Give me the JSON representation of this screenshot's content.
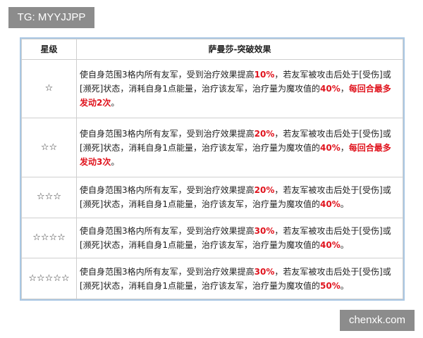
{
  "watermarks": {
    "top_left": "TG: MYYJJPP",
    "bottom_right": "chenxk.com"
  },
  "table": {
    "headers": [
      "星级",
      "萨曼莎-突破效果"
    ],
    "rows": [
      {
        "stars": "☆",
        "segments": [
          {
            "text": "使自身范围3格内所有友军，受到治疗效果提高",
            "highlight": false
          },
          {
            "text": "10%",
            "highlight": true
          },
          {
            "text": "，若友军被攻击后处于[受伤]或[濒死]状态，消耗自身1点能量，治疗该友军，治疗量为魔攻值的",
            "highlight": false
          },
          {
            "text": "40%",
            "highlight": true
          },
          {
            "text": "，",
            "highlight": false
          },
          {
            "text": "每回合最多发动2次",
            "highlight": true
          },
          {
            "text": "。",
            "highlight": false
          }
        ]
      },
      {
        "stars": "☆☆",
        "segments": [
          {
            "text": "使自身范围3格内所有友军，受到治疗效果提高",
            "highlight": false
          },
          {
            "text": "20%",
            "highlight": true
          },
          {
            "text": "，若友军被攻击后处于[受伤]或[濒死]状态，消耗自身1点能量，治疗该友军，治疗量为魔攻值的",
            "highlight": false
          },
          {
            "text": "40%",
            "highlight": true
          },
          {
            "text": "，",
            "highlight": false
          },
          {
            "text": "每回合最多发动3次",
            "highlight": true
          },
          {
            "text": "。",
            "highlight": false
          }
        ]
      },
      {
        "stars": "☆☆☆",
        "segments": [
          {
            "text": "使自身范围3格内所有友军，受到治疗效果提高",
            "highlight": false
          },
          {
            "text": "20%",
            "highlight": true
          },
          {
            "text": "，若友军被攻击后处于[受伤]或[濒死]状态，消耗自身1点能量，治疗该友军，治疗量为魔攻值的",
            "highlight": false
          },
          {
            "text": "40%",
            "highlight": true
          },
          {
            "text": "。",
            "highlight": false
          }
        ]
      },
      {
        "stars": "☆☆☆☆",
        "segments": [
          {
            "text": "使自身范围3格内所有友军，受到治疗效果提高",
            "highlight": false
          },
          {
            "text": "30%",
            "highlight": true
          },
          {
            "text": "，若友军被攻击后处于[受伤]或[濒死]状态，消耗自身1点能量，治疗该友军，治疗量为魔攻值的",
            "highlight": false
          },
          {
            "text": "40%",
            "highlight": true
          },
          {
            "text": "。",
            "highlight": false
          }
        ]
      },
      {
        "stars": "☆☆☆☆☆",
        "segments": [
          {
            "text": "使自身范围3格内所有友军，受到治疗效果提高",
            "highlight": false
          },
          {
            "text": "30%",
            "highlight": true
          },
          {
            "text": "，若友军被攻击后处于[受伤]或[濒死]状态，消耗自身1点能量，治疗该友军，治疗量为魔攻值的",
            "highlight": false
          },
          {
            "text": "50%",
            "highlight": true
          },
          {
            "text": "。",
            "highlight": false
          }
        ]
      }
    ]
  },
  "colors": {
    "highlight": "#e0141e",
    "table_border": "#a9c7e3",
    "watermark_bg": "#8c8c8c"
  }
}
